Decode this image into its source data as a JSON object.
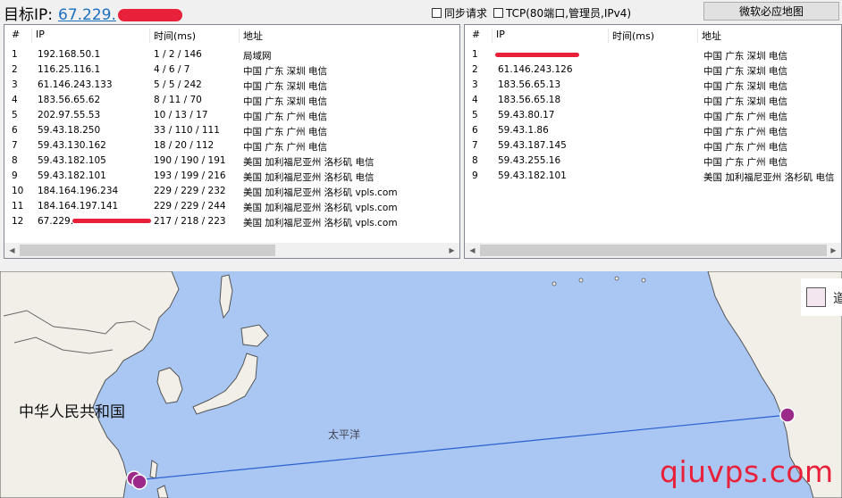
{
  "topbar": {
    "target_label": "目标IP:",
    "target_ip_visible": "67.229.",
    "sync_label": "同步请求",
    "tcp_label": "TCP(80端口,管理员,IPv4)",
    "map_button": "微软必应地图"
  },
  "left_table": {
    "headers": [
      "#",
      "IP",
      "时间(ms)",
      "地址"
    ],
    "rows": [
      {
        "n": "1",
        "ip": "192.168.50.1",
        "time": "1 / 2 / 146",
        "addr": "局域网"
      },
      {
        "n": "2",
        "ip": "116.25.116.1",
        "time": "4 / 6 / 7",
        "addr": "中国 广东 深圳 电信"
      },
      {
        "n": "3",
        "ip": "61.146.243.133",
        "time": "5 / 5 / 242",
        "addr": "中国 广东 深圳 电信"
      },
      {
        "n": "4",
        "ip": "183.56.65.62",
        "time": "8 / 11 / 70",
        "addr": "中国 广东 深圳 电信"
      },
      {
        "n": "5",
        "ip": "202.97.55.53",
        "time": "10 / 13 / 17",
        "addr": "中国 广东 广州 电信"
      },
      {
        "n": "6",
        "ip": "59.43.18.250",
        "time": "33 / 110 / 111",
        "addr": "中国 广东 广州 电信"
      },
      {
        "n": "7",
        "ip": "59.43.130.162",
        "time": "18 / 20 / 112",
        "addr": "中国 广东 广州 电信"
      },
      {
        "n": "8",
        "ip": "59.43.182.105",
        "time": "190 / 190 / 191",
        "addr": "美国 加利福尼亚州 洛杉矶 电信"
      },
      {
        "n": "9",
        "ip": "59.43.182.101",
        "time": "193 / 199 / 216",
        "addr": "美国 加利福尼亚州 洛杉矶 电信"
      },
      {
        "n": "10",
        "ip": "184.164.196.234",
        "time": "229 / 229 / 232",
        "addr": "美国 加利福尼亚州 洛杉矶 vpls.com"
      },
      {
        "n": "11",
        "ip": "184.164.197.141",
        "time": "229 / 229 / 244",
        "addr": "美国 加利福尼亚州 洛杉矶 vpls.com"
      },
      {
        "n": "12",
        "ip": "67.229.",
        "time": "217 / 218 / 223",
        "addr": "美国 加利福尼亚州 洛杉矶 vpls.com"
      }
    ]
  },
  "right_table": {
    "headers": [
      "#",
      "IP",
      "时间(ms)",
      "地址"
    ],
    "rows": [
      {
        "n": "1",
        "ip": "",
        "time": "",
        "addr": "中国 广东 深圳 电信"
      },
      {
        "n": "2",
        "ip": "61.146.243.126",
        "time": "",
        "addr": "中国 广东 深圳 电信"
      },
      {
        "n": "3",
        "ip": "183.56.65.13",
        "time": "",
        "addr": "中国 广东 深圳 电信"
      },
      {
        "n": "4",
        "ip": "183.56.65.18",
        "time": "",
        "addr": "中国 广东 深圳 电信"
      },
      {
        "n": "5",
        "ip": "59.43.80.17",
        "time": "",
        "addr": "中国 广东 广州 电信"
      },
      {
        "n": "6",
        "ip": "59.43.1.86",
        "time": "",
        "addr": "中国 广东 广州 电信"
      },
      {
        "n": "7",
        "ip": "59.43.187.145",
        "time": "",
        "addr": "中国 广东 广州 电信"
      },
      {
        "n": "8",
        "ip": "59.43.255.16",
        "time": "",
        "addr": "中国 广东 广州 电信"
      },
      {
        "n": "9",
        "ip": "59.43.182.101",
        "time": "",
        "addr": "美国 加利福尼亚州 洛杉矶 电信"
      }
    ]
  },
  "map": {
    "country_label": "中华人民共和国",
    "ocean_label": "太平洋",
    "legend_text": "道",
    "route_color": "#2a5fcf",
    "marker_color": "#9b2a8a"
  },
  "watermark": "qiuvps.com",
  "colors": {
    "accent": "#1a6fbf",
    "redaction": "#e8203a"
  }
}
